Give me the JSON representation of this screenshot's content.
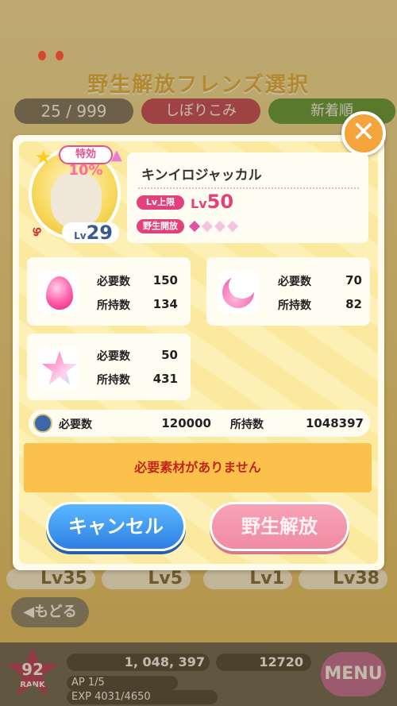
{
  "background": {
    "title": "野生解放フレンズ選択",
    "count": "25 / 999",
    "filter_label": "しぼりこみ",
    "sort_label": "新着順",
    "levels": [
      "Lv35",
      "Lv5",
      "Lv1",
      "Lv38"
    ],
    "back_label": "◀もどる",
    "rank_value": "92",
    "rank_label": "RANK",
    "coins": "1, 048, 397",
    "tickets": "12720",
    "ap": "AP 1/5",
    "exp": "EXP 4031/4650",
    "menu_label": "MENU"
  },
  "dialog": {
    "close_icon": "close-icon",
    "friend": {
      "name": "キンイロジャッカル",
      "level_prefix": "Lv",
      "level": "29",
      "tokkou_label": "特効",
      "tokkou_value": "10%",
      "lv_cap_label": "Lv上限",
      "lv_cap_prefix": "Lv",
      "lv_cap_value": "50",
      "wild_label": "野生開放",
      "wild_dots_filled": 1,
      "wild_dots_total": 4
    },
    "materials": [
      {
        "icon": "pink-drop-icon",
        "need_label": "必要数",
        "need": "150",
        "have_label": "所持数",
        "have": "134"
      },
      {
        "icon": "pink-crescent-icon",
        "need_label": "必要数",
        "need": "70",
        "have_label": "所持数",
        "have": "82"
      },
      {
        "icon": "rainbow-star-icon",
        "need_label": "必要数",
        "need": "50",
        "have_label": "所持数",
        "have": "431"
      }
    ],
    "coins": {
      "icon": "coin-icon",
      "need_label": "必要数",
      "need": "120000",
      "have_label": "所持数",
      "have": "1048397"
    },
    "warning": "必要素材がありません",
    "cancel_label": "キャンセル",
    "release_label": "野生解放"
  },
  "colors": {
    "accent_pink": "#e4417a",
    "cancel_blue": "#2f7fe3",
    "warning_bg": "#fbc14a",
    "warning_text": "#c0271c"
  }
}
